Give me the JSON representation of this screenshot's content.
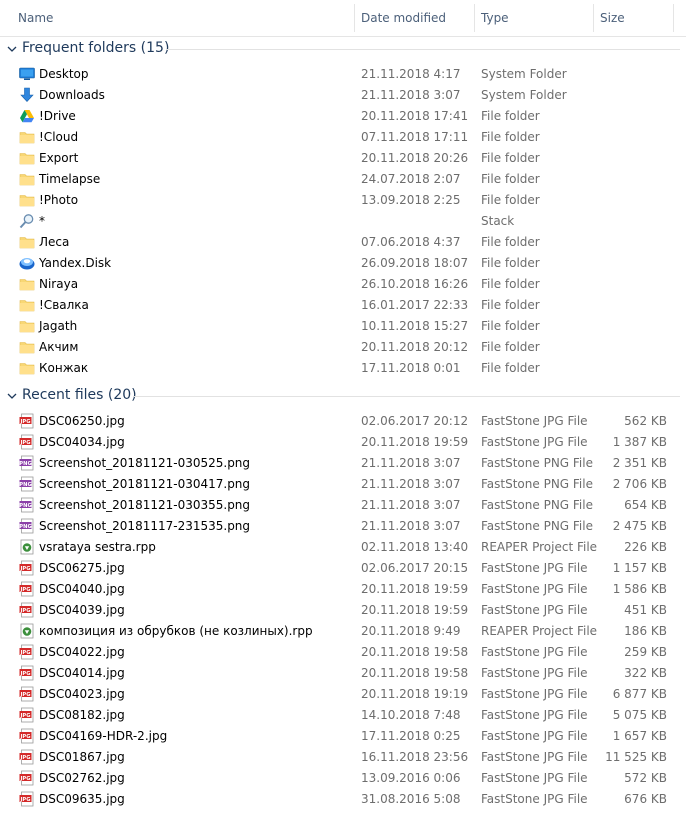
{
  "columns": {
    "name": "Name",
    "date": "Date modified",
    "type": "Type",
    "size": "Size"
  },
  "groups": {
    "frequent": {
      "title": "Frequent folders (15)",
      "items": [
        {
          "name": "Desktop",
          "date": "21.11.2018 4:17",
          "type": "System Folder",
          "size": "",
          "icon": "desktop-icon"
        },
        {
          "name": "Downloads",
          "date": "21.11.2018 3:07",
          "type": "System Folder",
          "size": "",
          "icon": "downloads-icon"
        },
        {
          "name": "!Drive",
          "date": "20.11.2018 17:41",
          "type": "File folder",
          "size": "",
          "icon": "google-drive-icon"
        },
        {
          "name": "!Cloud",
          "date": "07.11.2018 17:11",
          "type": "File folder",
          "size": "",
          "icon": "folder-icon"
        },
        {
          "name": "Export",
          "date": "20.11.2018 20:26",
          "type": "File folder",
          "size": "",
          "icon": "folder-icon"
        },
        {
          "name": "Timelapse",
          "date": "24.07.2018 2:07",
          "type": "File folder",
          "size": "",
          "icon": "folder-icon"
        },
        {
          "name": "!Photo",
          "date": "13.09.2018 2:25",
          "type": "File folder",
          "size": "",
          "icon": "folder-icon"
        },
        {
          "name": "*",
          "date": "",
          "type": "Stack",
          "size": "",
          "icon": "search-icon"
        },
        {
          "name": "Леса",
          "date": "07.06.2018 4:37",
          "type": "File folder",
          "size": "",
          "icon": "folder-icon"
        },
        {
          "name": "Yandex.Disk",
          "date": "26.09.2018 18:07",
          "type": "File folder",
          "size": "",
          "icon": "yandex-disk-icon"
        },
        {
          "name": "Niraya",
          "date": "26.10.2018 16:26",
          "type": "File folder",
          "size": "",
          "icon": "folder-icon"
        },
        {
          "name": "!Свалка",
          "date": "16.01.2017 22:33",
          "type": "File folder",
          "size": "",
          "icon": "folder-icon"
        },
        {
          "name": "Jagath",
          "date": "10.11.2018 15:27",
          "type": "File folder",
          "size": "",
          "icon": "folder-icon"
        },
        {
          "name": "Акчим",
          "date": "20.11.2018 20:12",
          "type": "File folder",
          "size": "",
          "icon": "folder-icon"
        },
        {
          "name": "Конжак",
          "date": "17.11.2018 0:01",
          "type": "File folder",
          "size": "",
          "icon": "folder-icon"
        }
      ]
    },
    "recent": {
      "title": "Recent files (20)",
      "items": [
        {
          "name": "DSC06250.jpg",
          "date": "02.06.2017 20:12",
          "type": "FastStone JPG File",
          "size": "562 KB",
          "icon": "jpg-file-icon"
        },
        {
          "name": "DSC04034.jpg",
          "date": "20.11.2018 19:59",
          "type": "FastStone JPG File",
          "size": "1 387 KB",
          "icon": "jpg-file-icon"
        },
        {
          "name": "Screenshot_20181121-030525.png",
          "date": "21.11.2018 3:07",
          "type": "FastStone PNG File",
          "size": "2 351 KB",
          "icon": "png-file-icon"
        },
        {
          "name": "Screenshot_20181121-030417.png",
          "date": "21.11.2018 3:07",
          "type": "FastStone PNG File",
          "size": "2 706 KB",
          "icon": "png-file-icon"
        },
        {
          "name": "Screenshot_20181121-030355.png",
          "date": "21.11.2018 3:07",
          "type": "FastStone PNG File",
          "size": "654 KB",
          "icon": "png-file-icon"
        },
        {
          "name": "Screenshot_20181117-231535.png",
          "date": "21.11.2018 3:07",
          "type": "FastStone PNG File",
          "size": "2 475 KB",
          "icon": "png-file-icon"
        },
        {
          "name": "vsrataya sestra.rpp",
          "date": "02.11.2018 13:40",
          "type": "REAPER Project File",
          "size": "226 KB",
          "icon": "reaper-file-icon"
        },
        {
          "name": "DSC06275.jpg",
          "date": "02.06.2017 20:15",
          "type": "FastStone JPG File",
          "size": "1 157 KB",
          "icon": "jpg-file-icon"
        },
        {
          "name": "DSC04040.jpg",
          "date": "20.11.2018 19:59",
          "type": "FastStone JPG File",
          "size": "1 586 KB",
          "icon": "jpg-file-icon"
        },
        {
          "name": "DSC04039.jpg",
          "date": "20.11.2018 19:59",
          "type": "FastStone JPG File",
          "size": "451 KB",
          "icon": "jpg-file-icon"
        },
        {
          "name": "композиция из обрубков (не козлиных).rpp",
          "date": "20.11.2018 9:49",
          "type": "REAPER Project File",
          "size": "186 KB",
          "icon": "reaper-file-icon"
        },
        {
          "name": "DSC04022.jpg",
          "date": "20.11.2018 19:58",
          "type": "FastStone JPG File",
          "size": "259 KB",
          "icon": "jpg-file-icon"
        },
        {
          "name": "DSC04014.jpg",
          "date": "20.11.2018 19:58",
          "type": "FastStone JPG File",
          "size": "322 KB",
          "icon": "jpg-file-icon"
        },
        {
          "name": "DSC04023.jpg",
          "date": "20.11.2018 19:19",
          "type": "FastStone JPG File",
          "size": "6 877 KB",
          "icon": "jpg-file-icon"
        },
        {
          "name": "DSC08182.jpg",
          "date": "14.10.2018 7:48",
          "type": "FastStone JPG File",
          "size": "5 075 KB",
          "icon": "jpg-file-icon"
        },
        {
          "name": "DSC04169-HDR-2.jpg",
          "date": "17.11.2018 0:25",
          "type": "FastStone JPG File",
          "size": "1 657 KB",
          "icon": "jpg-file-icon"
        },
        {
          "name": "DSC01867.jpg",
          "date": "16.11.2018 23:56",
          "type": "FastStone JPG File",
          "size": "11 525 KB",
          "icon": "jpg-file-icon"
        },
        {
          "name": "DSC02762.jpg",
          "date": "13.09.2016 0:06",
          "type": "FastStone JPG File",
          "size": "572 KB",
          "icon": "jpg-file-icon"
        },
        {
          "name": "DSC09635.jpg",
          "date": "31.08.2016 5:08",
          "type": "FastStone JPG File",
          "size": "676 KB",
          "icon": "jpg-file-icon"
        }
      ]
    }
  },
  "colors": {
    "group_title": "#1e395b",
    "header_text": "#4c607a",
    "detail_text": "#6d6d6d",
    "folder": "#f8d775",
    "jpg_badge": "#d42a2a",
    "png_badge": "#8b3fa8"
  }
}
